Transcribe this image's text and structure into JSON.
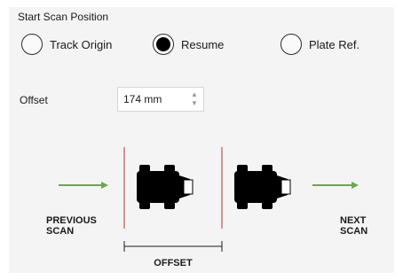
{
  "section": {
    "title": "Start Scan Position"
  },
  "options": [
    {
      "label": "Track Origin",
      "selected": false
    },
    {
      "label": "Resume",
      "selected": true
    },
    {
      "label": "Plate Ref.",
      "selected": false
    }
  ],
  "offset": {
    "label": "Offset",
    "value": "174 mm"
  },
  "diagram": {
    "previous_line1": "PREVIOUS",
    "previous_line2": "SCAN",
    "next_line1": "NEXT",
    "next_line2": "SCAN",
    "offset_caption": "OFFSET",
    "arrow_color": "#6aa84f",
    "marker_color": "#c0504d"
  }
}
